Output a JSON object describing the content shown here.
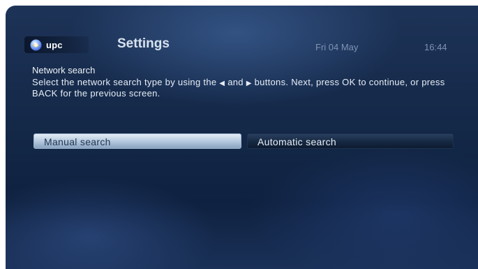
{
  "header": {
    "logo_text": "upc",
    "title": "Settings",
    "date": "Fri 04 May",
    "time": "16:44"
  },
  "body": {
    "subtitle": "Network search",
    "instructions_part1": "Select the network search type by using the ",
    "left_arrow": "◀",
    "instructions_and": " and ",
    "right_arrow": "▶",
    "instructions_part2": " buttons. Next, press OK to continue, or press BACK for the previous screen."
  },
  "options": {
    "manual_label": "Manual search",
    "automatic_label": "Automatic search",
    "selected": "Manual search"
  },
  "colors": {
    "background": "#142848",
    "selected_option": "#b6c9de",
    "unselected_option": "#152842",
    "header_text": "#d8e2ee",
    "secondary_text": "#7f93b3"
  },
  "icons": {
    "logo": "upc-swirl-icon",
    "left_arrow": "triangle-left-icon",
    "right_arrow": "triangle-right-icon"
  }
}
